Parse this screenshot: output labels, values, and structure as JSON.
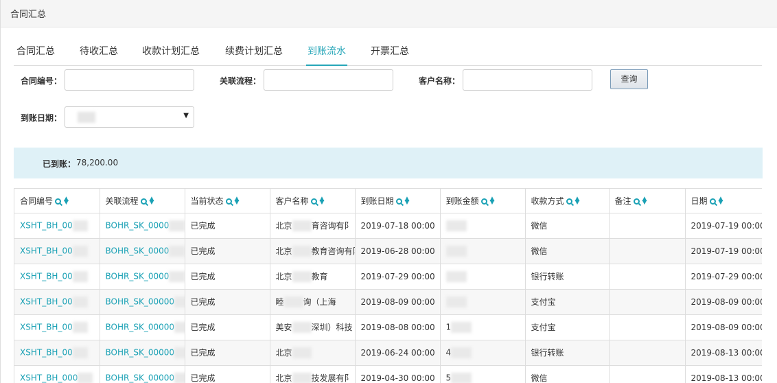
{
  "window": {
    "title": "合同汇总"
  },
  "tabs": [
    {
      "label": "合同汇总",
      "active": false
    },
    {
      "label": "待收汇总",
      "active": false
    },
    {
      "label": "收款计划汇总",
      "active": false
    },
    {
      "label": "续费计划汇总",
      "active": false
    },
    {
      "label": "到账流水",
      "active": true
    },
    {
      "label": "开票汇总",
      "active": false
    }
  ],
  "filters": {
    "contract_no_label": "合同编号：",
    "flow_label": "关联流程：",
    "customer_label": "客户名称：",
    "date_label": "到账日期：",
    "contract_no_value": "",
    "flow_value": "",
    "customer_value": "",
    "query_button": "查询"
  },
  "summary": {
    "label": "已到账：",
    "value": "78,200.00"
  },
  "colors": {
    "accent": "#26a6b8",
    "link": "#1aa1b5",
    "summary_bg": "#dff1f7"
  },
  "table": {
    "columns": [
      "合同编号",
      "关联流程",
      "当前状态",
      "客户名称",
      "到账日期",
      "到账金额",
      "收款方式",
      "备注",
      "日期"
    ],
    "rows": [
      {
        "contract": "XSHT_BH_00",
        "flow": "BOHR_SK_0000",
        "status": "已完成",
        "customer_a": "北京",
        "customer_b": "育咨询有阝",
        "arrive_date": "2019-07-18 00:00",
        "amount": "",
        "method": "微信",
        "note": "",
        "date": "2019-07-19 00:00"
      },
      {
        "contract": "XSHT_BH_00",
        "flow": "BOHR_SK_0000",
        "status": "已完成",
        "customer_a": "北京",
        "customer_b": "教育咨询有阝",
        "arrive_date": "2019-06-28 00:00",
        "amount": "",
        "method": "微信",
        "note": "",
        "date": "2019-07-19 00:00"
      },
      {
        "contract": "XSHT_BH_00",
        "flow": "BOHR_SK_0000",
        "status": "已完成",
        "customer_a": "北京",
        "customer_b": "教育",
        "arrive_date": "2019-07-29 00:00",
        "amount": "",
        "method": "银行转账",
        "note": "",
        "date": "2019-07-29 00:00"
      },
      {
        "contract": "XSHT_BH_00",
        "flow": "BOHR_SK_00000",
        "status": "已完成",
        "customer_a": "睦",
        "customer_b": "询（上海",
        "arrive_date": "2019-08-09 00:00",
        "amount": "",
        "method": "支付宝",
        "note": "",
        "date": "2019-08-09 00:00"
      },
      {
        "contract": "XSHT_BH_00",
        "flow": "BOHR_SK_00000",
        "status": "已完成",
        "customer_a": "美安",
        "customer_b": "深圳）科技",
        "arrive_date": "2019-08-08 00:00",
        "amount": "1",
        "method": "支付宝",
        "note": "",
        "date": "2019-08-09 00:00"
      },
      {
        "contract": "XSHT_BH_00",
        "flow": "BOHR_SK_00000",
        "status": "已完成",
        "customer_a": "北京",
        "customer_b": "",
        "arrive_date": "2019-06-24 00:00",
        "amount": "4",
        "method": "银行转账",
        "note": "",
        "date": "2019-08-13 00:00"
      },
      {
        "contract": "XSHT_BH_000",
        "flow": "BOHR_SK_00000",
        "status": "已完成",
        "customer_a": "北京",
        "customer_b": "技发展有阝",
        "arrive_date": "2019-04-30 00:00",
        "amount": "5",
        "method": "微信",
        "note": "",
        "date": "2019-08-13 00:00"
      }
    ]
  }
}
